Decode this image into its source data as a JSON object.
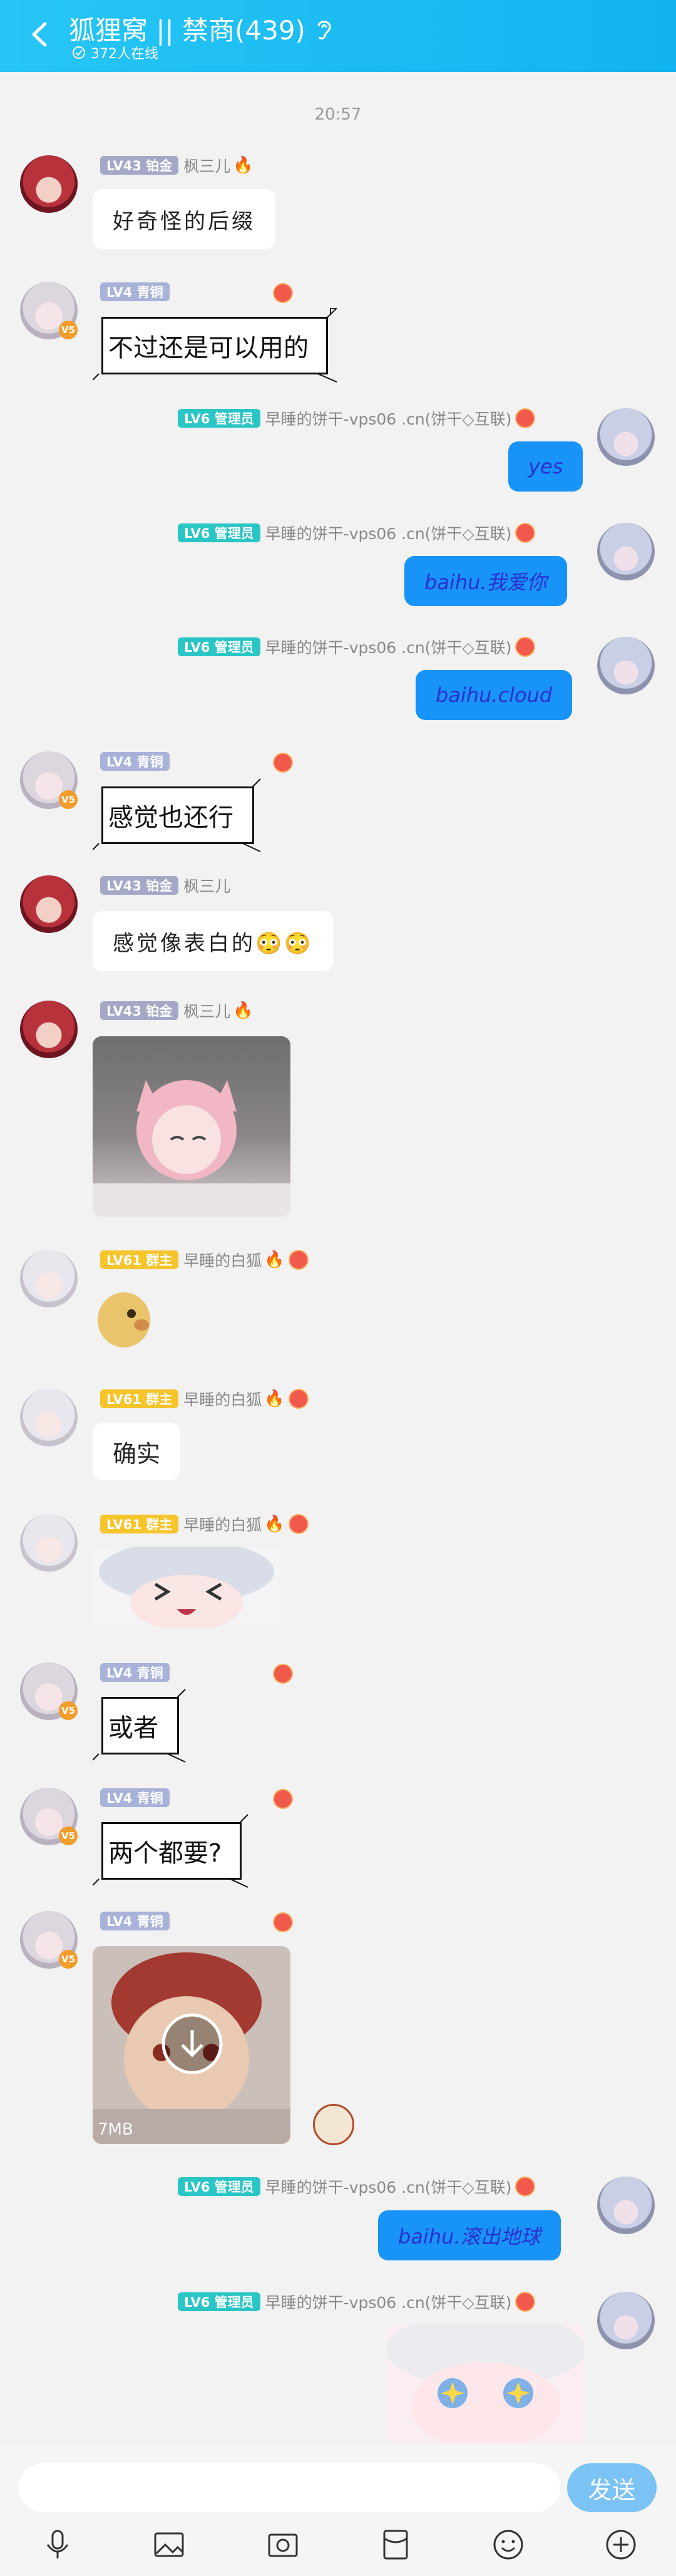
{
  "header": {
    "title": "狐狸窝 || 禁商(439)",
    "online": "372人在线"
  },
  "time": "20:57",
  "names": {
    "fengsan": "枫三儿",
    "baihu": "早睡的白狐",
    "bing": "早睡的饼干-vps06 .cn(饼干◇互联)"
  },
  "levels": {
    "pt": "LV43 铂金",
    "qt": "LV4 青铜",
    "gz": "LV61 群主",
    "gly": "LV6 管理员"
  },
  "messages": {
    "m1": "好奇怪的后缀",
    "m2": "不过还是可以用的",
    "m3": "yes",
    "m4": "baihu.我爱你",
    "m5": "baihu.cloud",
    "m6": "感觉也还行",
    "m7": "感觉像表白的😳😳",
    "m10": "确实",
    "m12": "或者",
    "m13": "两个都要?",
    "m14_size": "7MB",
    "m15": "baihu.滚出地球"
  },
  "composer": {
    "send": "发送"
  },
  "colors": {
    "header": "#12b3f0",
    "bubble_blue": "#1893f8",
    "send": "#7ac3f4"
  }
}
